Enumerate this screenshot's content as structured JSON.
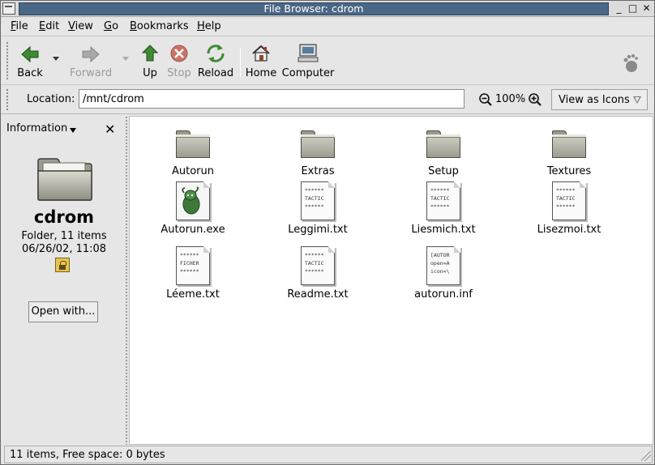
{
  "window": {
    "title": "File Browser: cdrom",
    "controls": {
      "minimize": "_",
      "maximize": "□",
      "close": "✕"
    }
  },
  "menubar": {
    "items": [
      {
        "label": "File",
        "underline": "F",
        "rest": "ile"
      },
      {
        "label": "Edit",
        "underline": "E",
        "rest": "dit"
      },
      {
        "label": "View",
        "underline": "V",
        "rest": "iew"
      },
      {
        "label": "Go",
        "underline": "G",
        "rest": "o"
      },
      {
        "label": "Bookmarks",
        "underline": "B",
        "rest": "ookmarks"
      },
      {
        "label": "Help",
        "underline": "H",
        "rest": "elp"
      }
    ]
  },
  "toolbar": {
    "back": "Back",
    "forward": "Forward",
    "up": "Up",
    "stop": "Stop",
    "reload": "Reload",
    "home": "Home",
    "computer": "Computer",
    "colors": {
      "arrow_green": "#3d8a32",
      "stop_red": "#c44a3c"
    }
  },
  "location": {
    "label": "Location:",
    "value": "/mnt/cdrom",
    "zoom": "100%",
    "view_as": "View as Icons"
  },
  "sidepane": {
    "title": "Information",
    "folder_name": "cdrom",
    "kind": "Folder, 11 items",
    "modified": "06/26/02, 11:08",
    "open_with": "Open with..."
  },
  "files": [
    {
      "name": "Autorun",
      "type": "folder"
    },
    {
      "name": "Extras",
      "type": "folder"
    },
    {
      "name": "Setup",
      "type": "folder"
    },
    {
      "name": "Textures",
      "type": "folder"
    },
    {
      "name": "Autorun.exe",
      "type": "exe"
    },
    {
      "name": "Leggimi.txt",
      "type": "doc",
      "preview": "******\nTACTIC\n******"
    },
    {
      "name": "Liesmich.txt",
      "type": "doc",
      "preview": "******\nTACTIC\n******"
    },
    {
      "name": "Lisezmoi.txt",
      "type": "doc",
      "preview": "******\nTACTIC\n******"
    },
    {
      "name": "Léeme.txt",
      "type": "doc",
      "preview": "******\nFICHER\n******"
    },
    {
      "name": "Readme.txt",
      "type": "doc",
      "preview": "******\nTACTIC\n******"
    },
    {
      "name": "autorun.inf",
      "type": "doc",
      "preview": "[AUTOR\nopen=A\nicon=\\"
    }
  ],
  "status": {
    "text": "11 items, Free space: 0 bytes"
  }
}
